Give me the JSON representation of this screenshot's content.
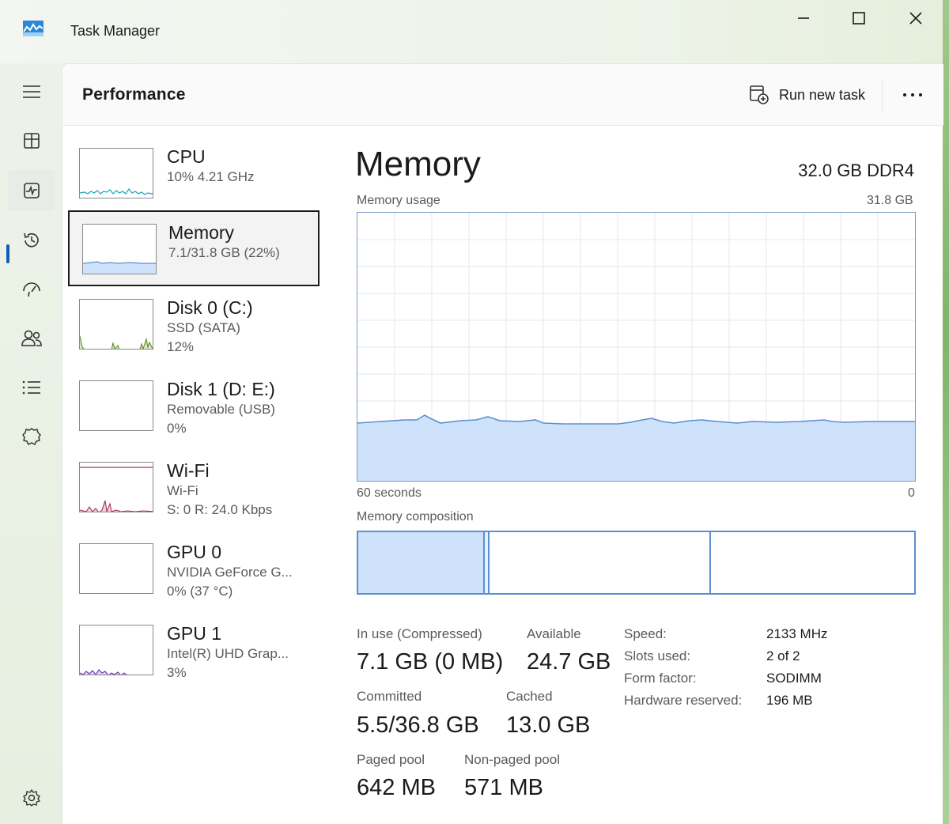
{
  "window": {
    "title": "Task Manager",
    "controls": {
      "minimize": "minimize-icon",
      "maximize": "maximize-icon",
      "close": "close-icon"
    }
  },
  "nav": {
    "items": [
      {
        "id": "menu",
        "icon": "hamburger-icon"
      },
      {
        "id": "processes",
        "icon": "processes-icon"
      },
      {
        "id": "performance",
        "icon": "performance-icon",
        "active": true
      },
      {
        "id": "app-history",
        "icon": "history-icon"
      },
      {
        "id": "startup",
        "icon": "startup-icon"
      },
      {
        "id": "users",
        "icon": "users-icon"
      },
      {
        "id": "details",
        "icon": "details-icon"
      },
      {
        "id": "services",
        "icon": "services-icon"
      }
    ],
    "settings_icon": "gear-icon"
  },
  "header": {
    "title": "Performance",
    "run_new_task": "Run new task",
    "more": "more-icon"
  },
  "resources": [
    {
      "title": "CPU",
      "lines": [
        "10%  4.21 GHz"
      ],
      "color": "#1aa3b4"
    },
    {
      "title": "Memory",
      "lines": [
        "7.1/31.8 GB (22%)"
      ],
      "color": "#5c8fd0",
      "selected": true
    },
    {
      "title": "Disk 0 (C:)",
      "lines": [
        "SSD (SATA)",
        "12%"
      ],
      "color": "#5b8a1e"
    },
    {
      "title": "Disk 1 (D: E:)",
      "lines": [
        "Removable (USB)",
        "0%"
      ],
      "color": "#5b8a1e"
    },
    {
      "title": "Wi-Fi",
      "lines": [
        "Wi-Fi",
        "S: 0  R: 24.0 Kbps"
      ],
      "color": "#a8305c"
    },
    {
      "title": "GPU 0",
      "lines": [
        "NVIDIA GeForce G...",
        "0%  (37 °C)"
      ],
      "color": "#6e2fb9"
    },
    {
      "title": "GPU 1",
      "lines": [
        "Intel(R) UHD Grap...",
        "3%"
      ],
      "color": "#6e2fb9"
    }
  ],
  "detail": {
    "title": "Memory",
    "spec": "32.0 GB DDR4",
    "usage_label": "Memory usage",
    "usage_max": "31.8 GB",
    "time_left": "60 seconds",
    "time_right": "0",
    "composition_label": "Memory composition",
    "stats": {
      "in_use_label": "In use (Compressed)",
      "in_use_value": "7.1 GB (0 MB)",
      "available_label": "Available",
      "available_value": "24.7 GB",
      "committed_label": "Committed",
      "committed_value": "5.5/36.8 GB",
      "cached_label": "Cached",
      "cached_value": "13.0 GB",
      "paged_label": "Paged pool",
      "paged_value": "642 MB",
      "nonpaged_label": "Non-paged pool",
      "nonpaged_value": "571 MB"
    },
    "properties": [
      {
        "key": "Speed:",
        "value": "2133 MHz"
      },
      {
        "key": "Slots used:",
        "value": "2 of 2"
      },
      {
        "key": "Form factor:",
        "value": "SODIMM"
      },
      {
        "key": "Hardware reserved:",
        "value": "196 MB"
      }
    ]
  },
  "colors": {
    "memory_fill": "#cfe2fb",
    "memory_line": "#5c8fd0",
    "grid": "#e2e8f0",
    "accent": "#0f5fb5"
  }
}
